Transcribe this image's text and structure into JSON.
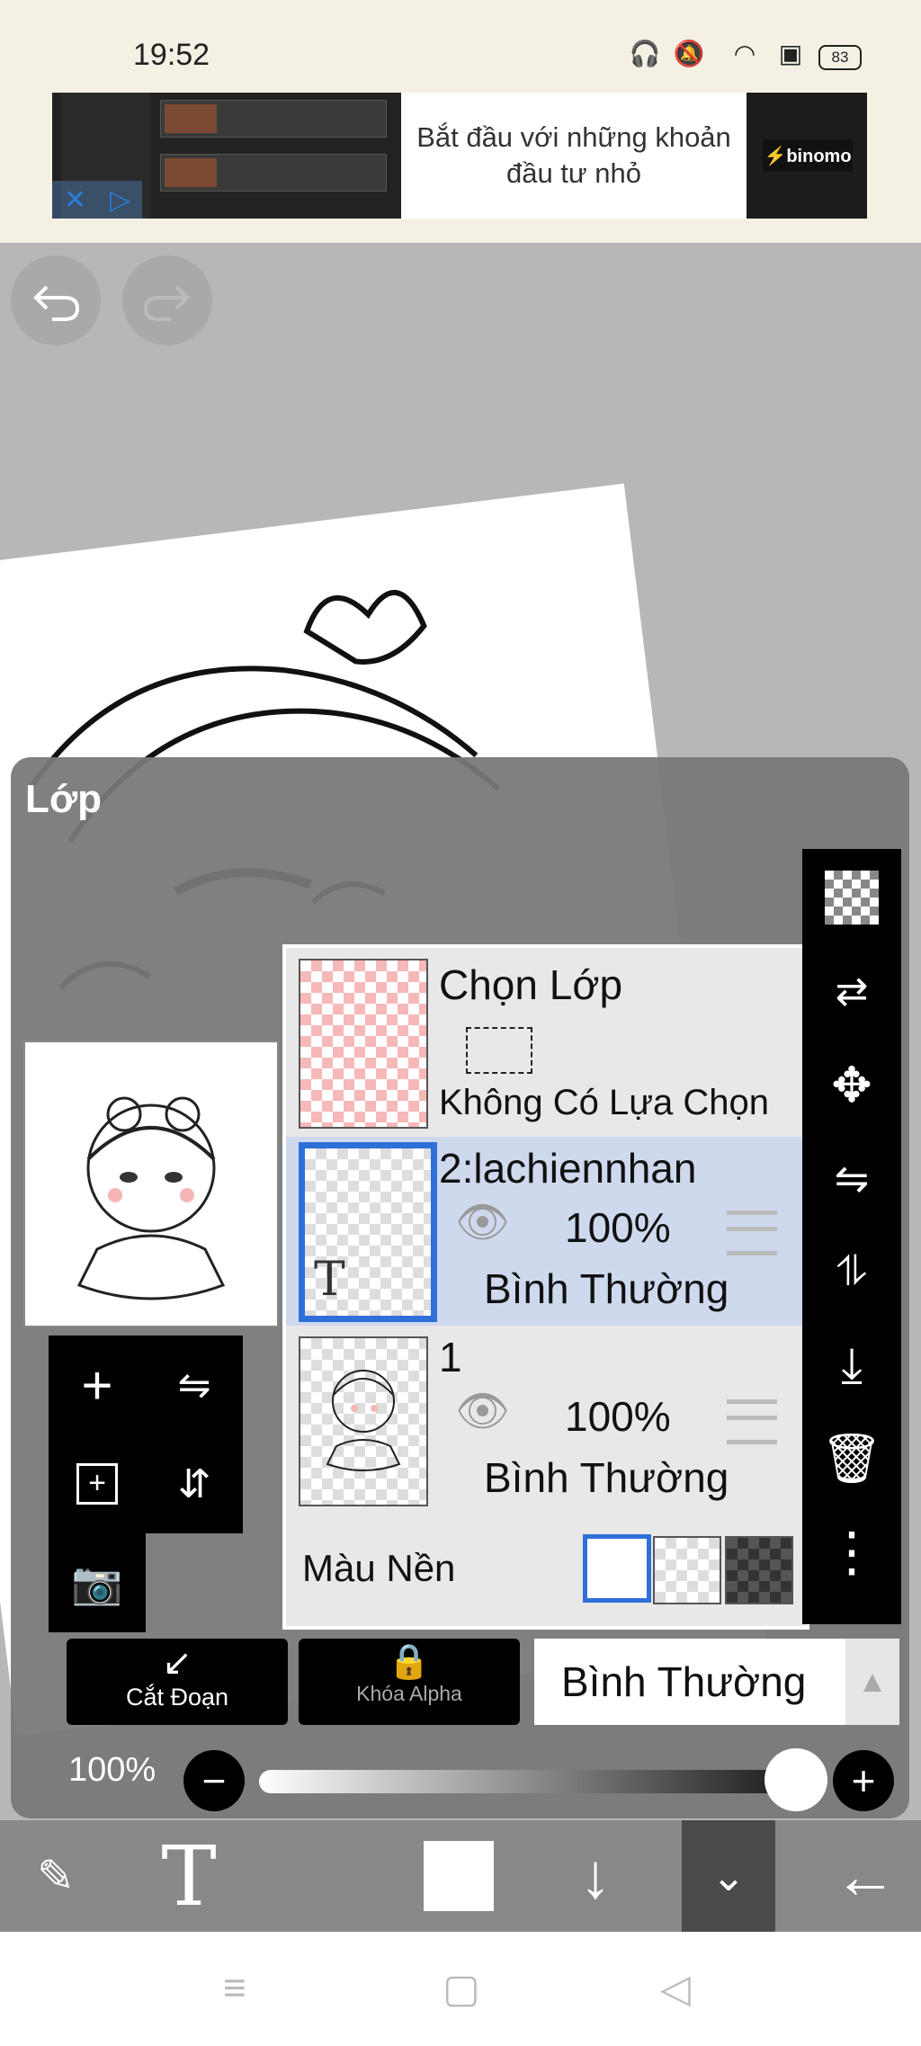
{
  "status": {
    "time": "19:52",
    "battery": "83"
  },
  "ad": {
    "text": "Bắt đầu với những khoản đầu tư nhỏ",
    "brand": "⚡binomo",
    "close": "✕",
    "play": "▷"
  },
  "panel": {
    "title": "Lớp",
    "layers": [
      {
        "name": "Chọn Lớp",
        "sub": "Không Có Lựa Chọn"
      },
      {
        "name": "2:lachiennhan",
        "opacity": "100%",
        "blend": "Bình Thường",
        "text_marker": "T"
      },
      {
        "name": "1",
        "opacity": "100%",
        "blend": "Bình Thường"
      }
    ],
    "background_label": "Màu Nền",
    "actions": {
      "clip": "Cắt Đoạn",
      "alpha_lock": "Khóa Alpha"
    },
    "blend_mode": "Bình Thường",
    "opacity": "100%"
  },
  "icons": {
    "undo": "undo-icon",
    "redo": "redo-icon",
    "add": "add-icon",
    "eye": "eye-icon",
    "trash": "trash-icon",
    "more": "more-icon",
    "camera": "camera-icon"
  },
  "colors": {
    "selected_layer": "#cfd9ee",
    "selected_border": "#2f6fd8",
    "panel_bg": "#787878"
  }
}
